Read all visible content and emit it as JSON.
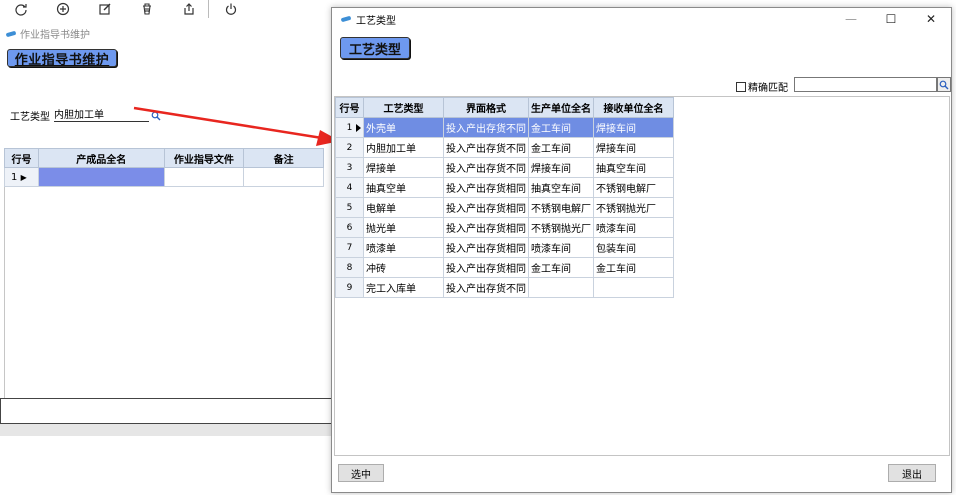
{
  "toolbar": {
    "icons": [
      "refresh-icon",
      "add-icon",
      "edit-icon",
      "delete-icon",
      "export-icon",
      "power-icon"
    ]
  },
  "main": {
    "window_title": "作业指导书维护",
    "heading": "作业指导书维护",
    "process_type_label": "工艺类型",
    "process_type_value": "内胆加工单",
    "table": {
      "headers": [
        "行号",
        "产成品全名",
        "作业指导文件",
        "备注"
      ],
      "rows": [
        {
          "row_no": "1",
          "product": "",
          "doc": "",
          "note": ""
        }
      ]
    }
  },
  "dialog": {
    "title": "工艺类型",
    "heading": "工艺类型",
    "precise_match_label": "精确匹配",
    "search_value": "",
    "table": {
      "headers": [
        "行号",
        "工艺类型",
        "界面格式",
        "生产单位全名",
        "接收单位全名"
      ],
      "rows": [
        {
          "row_no": "1",
          "type": "外壳单",
          "format": "投入产出存货不同",
          "producer": "金工车间",
          "receiver": "焊接车间"
        },
        {
          "row_no": "2",
          "type": "内胆加工单",
          "format": "投入产出存货不同",
          "producer": "金工车间",
          "receiver": "焊接车间"
        },
        {
          "row_no": "3",
          "type": "焊接单",
          "format": "投入产出存货不同",
          "producer": "焊接车间",
          "receiver": "抽真空车间"
        },
        {
          "row_no": "4",
          "type": "抽真空单",
          "format": "投入产出存货相同",
          "producer": "抽真空车间",
          "receiver": "不锈钢电解厂"
        },
        {
          "row_no": "5",
          "type": "电解单",
          "format": "投入产出存货相同",
          "producer": "不锈钢电解厂",
          "receiver": "不锈钢抛光厂"
        },
        {
          "row_no": "6",
          "type": "抛光单",
          "format": "投入产出存货相同",
          "producer": "不锈钢抛光厂",
          "receiver": "喷漆车间"
        },
        {
          "row_no": "7",
          "type": "喷漆单",
          "format": "投入产出存货相同",
          "producer": "喷漆车间",
          "receiver": "包装车间"
        },
        {
          "row_no": "8",
          "type": "冲砖",
          "format": "投入产出存货相同",
          "producer": "金工车间",
          "receiver": "金工车间"
        },
        {
          "row_no": "9",
          "type": "完工入库单",
          "format": "投入产出存货不同",
          "producer": "",
          "receiver": ""
        }
      ]
    },
    "select_button": "选中",
    "exit_button": "退出"
  },
  "colors": {
    "accent_button": "#6e99ef",
    "selected_row": "#6f8de3",
    "arrow": "#e8261f",
    "header_bg": "#dbe5f3"
  }
}
